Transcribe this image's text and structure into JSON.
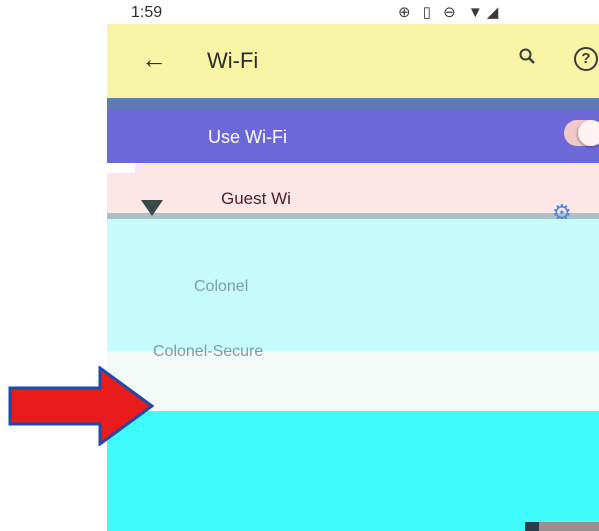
{
  "status_bar": {
    "time": "1:59",
    "icons_text": "⊕ ▯ ⊖ ▼◢"
  },
  "appbar": {
    "back_icon": "←",
    "title": "Wi-Fi",
    "help_icon": "?"
  },
  "use_wifi": {
    "label": "Use Wi-Fi",
    "enabled": true
  },
  "networks": {
    "connected": {
      "name": "Guest Wi"
    },
    "others": [
      {
        "name": "Colonel"
      },
      {
        "name": "Colonel-Secure"
      }
    ]
  },
  "colors": {
    "appbar": "#f8f5a6",
    "use_wifi_row": "#6d68d8",
    "cyan_panel": "#c7fcfc",
    "bright_panel": "#3ffcfc",
    "arrow": "#ea1b1b",
    "arrow_outline": "#1f4aa8"
  }
}
